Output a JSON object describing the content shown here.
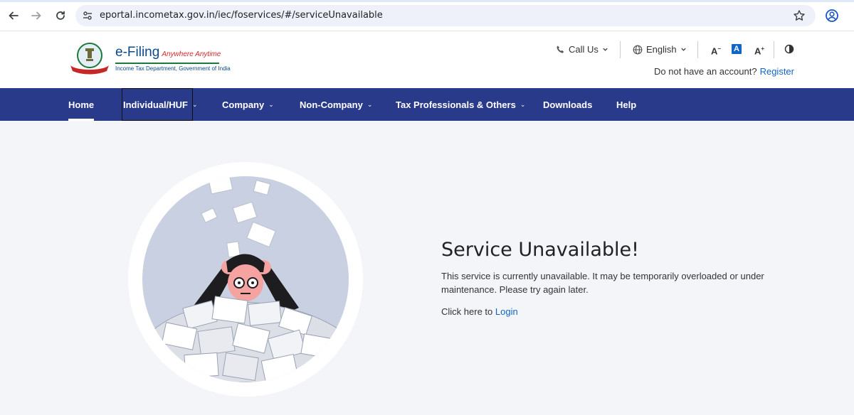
{
  "browser": {
    "url": "eportal.incometax.gov.in/iec/foservices/#/serviceUnavailable"
  },
  "header": {
    "logo_title": "e-Filing",
    "logo_tagline": "Anywhere Anytime",
    "logo_subtitle": "Income Tax Department, Government of India",
    "call_us": "Call Us",
    "language": "English",
    "font_decrease": "A",
    "font_normal": "A",
    "font_increase": "A",
    "account_prompt": "Do not have an account?",
    "register": "Register"
  },
  "menu": {
    "items": [
      {
        "label": "Home"
      },
      {
        "label": "Individual/HUF"
      },
      {
        "label": "Company"
      },
      {
        "label": "Non-Company"
      },
      {
        "label": "Tax Professionals & Others"
      },
      {
        "label": "Downloads"
      },
      {
        "label": "Help"
      }
    ]
  },
  "message": {
    "title": "Service Unavailable!",
    "body": "This service is currently unavailable. It may be temporarily overloaded or under maintenance. Please try again later.",
    "login_prompt": "Click here to",
    "login_link": "Login"
  },
  "colors": {
    "menu_bg": "#2a3a8a",
    "link": "#1166c5",
    "page_bg": "#f4f5f9"
  }
}
